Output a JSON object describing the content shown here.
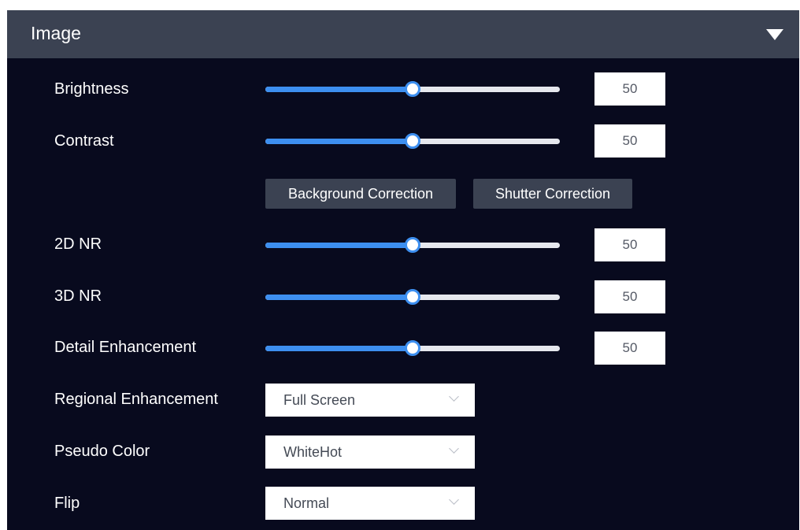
{
  "panel": {
    "title": "Image"
  },
  "sliders": [
    {
      "label": "Brightness",
      "value": "50",
      "level": 0.5
    },
    {
      "label": "Contrast",
      "value": "50",
      "level": 0.5
    },
    {
      "label": "2D NR",
      "value": "50",
      "level": 0.5
    },
    {
      "label": "3D NR",
      "value": "50",
      "level": 0.5
    },
    {
      "label": "Detail Enhancement",
      "value": "50",
      "level": 0.5
    }
  ],
  "buttons": {
    "background_correction": "Background Correction",
    "shutter_correction": "Shutter Correction"
  },
  "selects": [
    {
      "label": "Regional Enhancement",
      "value": "Full Screen"
    },
    {
      "label": "Pseudo Color",
      "value": "WhiteHot"
    },
    {
      "label": "Flip",
      "value": "Normal"
    }
  ],
  "colors": {
    "panel_bg": "#080a1e",
    "header_bg": "#3b4252",
    "accent": "#3d8ff0"
  },
  "icons": {
    "collapse": "triangle-down-icon",
    "dropdown": "chevron-down-icon"
  }
}
